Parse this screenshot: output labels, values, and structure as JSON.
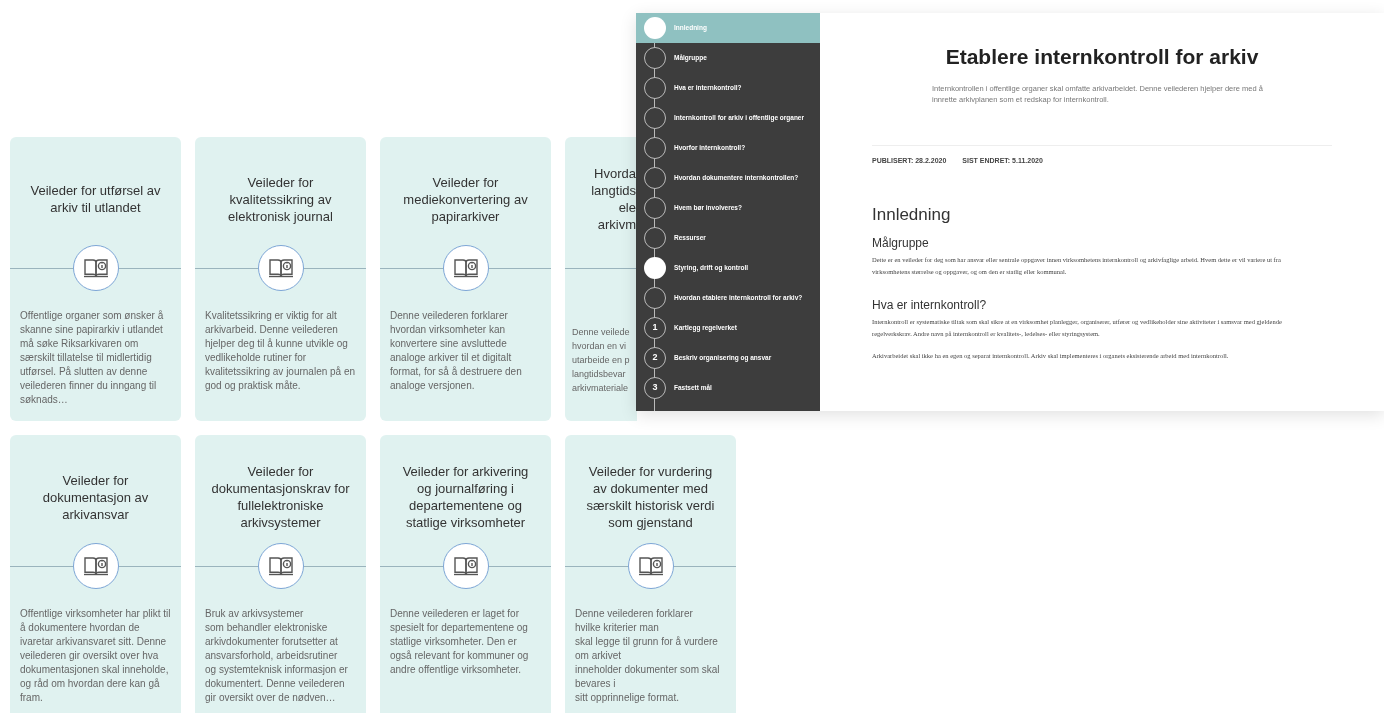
{
  "cards": [
    {
      "kind": "full",
      "title": "Veileder for utførsel av arkiv til utlandet",
      "body": "Offentlige organer som ønsker å skanne sine papirarkiv i utlandet må søke Riksarkivaren om særskilt tillatelse til midlertidig utførsel. På slutten av denne veilederen finner du inngang til søknads…"
    },
    {
      "kind": "full",
      "title": "Veileder for kvalitetssikring av elektronisk journal",
      "body": "Kvalitetssikring er viktig for alt arkivarbeid. Denne veilederen hjelper deg til å kunne utvikle og vedlikeholde rutiner for kvalitetssikring av journalen på en god og praktisk måte."
    },
    {
      "kind": "full",
      "title": "Veileder for mediekonvertering av papirarkiver",
      "body": "Denne veilederen forklarer hvordan virksomheter kan konvertere sine avsluttede analoge arkiver til et digitalt format, for så å destruere den analoge versjonen."
    },
    {
      "kind": "covered",
      "title_fragments": [
        "Hvorda",
        "langtids",
        "ele",
        "arkivm"
      ],
      "body_fragments": [
        "Denne veilede",
        "hvordan en vi",
        "utarbeide en p",
        "langtidsbevar",
        "arkivmateriale"
      ]
    },
    {
      "kind": "full",
      "title": "Veileder for dokumentasjon av arkivansvar",
      "body": "Offentlige virksomheter har plikt til å dokumentere hvordan de ivaretar arkivansvaret sitt. Denne veilederen gir oversikt over hva dokumentasjonen skal inneholde, og råd om hvordan dere kan gå fram."
    },
    {
      "kind": "full",
      "title": "Veileder for dokumentasjonskrav for fullelektroniske arkivsystemer",
      "body": "Bruk av arkivsystemer\nsom behandler elektroniske arkivdokumenter forutsetter at ansvarsforhold, arbeidsrutiner\nog systemteknisk informasjon er dokumentert. Denne veilederen gir oversikt over de nødven…"
    },
    {
      "kind": "full",
      "title": "Veileder for arkivering og journalføring i departementene og statlige virksomheter",
      "body": "Denne veilederen er laget for spesielt for departementene og statlige virksomheter. Den er også relevant for kommuner og andre offentlige virksomheter."
    },
    {
      "kind": "full",
      "title": "Veileder for vurdering av dokumenter med særskilt historisk verdi som gjenstand",
      "body": "Denne veilederen forklarer\nhvilke kriterier man\nskal legge til grunn for å vurdere\nom arkivet\ninneholder dokumenter som skal\nbevares i\nsitt opprinnelige format."
    }
  ],
  "preview": {
    "sidebar": {
      "items": [
        {
          "label": "Innledning",
          "kind": "section",
          "selected": true
        },
        {
          "label": "Målgruppe",
          "kind": "topic",
          "selected": false
        },
        {
          "label": "Hva er internkontroll?",
          "kind": "topic",
          "selected": false
        },
        {
          "label": "Internkontroll for arkiv i offentlige organer",
          "kind": "topic",
          "selected": false
        },
        {
          "label": "Hvorfor internkontroll?",
          "kind": "topic",
          "selected": false
        },
        {
          "label": "Hvordan dokumentere internkontrollen?",
          "kind": "topic",
          "selected": false
        },
        {
          "label": "Hvem bør involveres?",
          "kind": "topic",
          "selected": false
        },
        {
          "label": "Ressurser",
          "kind": "topic",
          "selected": false
        },
        {
          "label": "Styring, drift og kontroll",
          "kind": "section",
          "selected": false
        },
        {
          "label": "Hvordan etablere internkontroll for arkiv?",
          "kind": "topic",
          "selected": false
        },
        {
          "label": "Kartlegg regelverket",
          "kind": "step",
          "number": "1",
          "selected": false
        },
        {
          "label": "Beskriv organisering og ansvar",
          "kind": "step",
          "number": "2",
          "selected": false
        },
        {
          "label": "Fastsett mål",
          "kind": "step",
          "number": "3",
          "selected": false
        }
      ]
    },
    "title": "Etablere internkontroll for arkiv",
    "lead": "Internkontrollen i offentlige organer skal omfatte arkivarbeidet. Denne veilederen hjelper dere med å innrette arkivplanen som et redskap for internkontroll.",
    "meta": [
      "PUBLISERT: 28.2.2020",
      "SIST ENDRET: 5.11.2020"
    ],
    "section_heading": "Innledning",
    "subsections": [
      {
        "heading": "Målgruppe",
        "paragraphs": [
          "Dette er en veileder for deg som har ansvar eller sentrale oppgaver innen virksomhetens internkontroll og arkivfaglige arbeid. Hvem dette er vil variere ut fra virksomhetens størrelse og oppgaver, og om den er statlig eller kommunal."
        ]
      },
      {
        "heading": "Hva er internkontroll?",
        "paragraphs": [
          "Internkontroll er systematiske tiltak som skal sikre at en virksomhet planlegger, organiserer, utfører og vedlikeholder sine aktiviteter i samsvar med gjeldende regelverkskrav. Andre navn på internkontroll er kvalitets-, ledelses- eller styringsystem.",
          "Arkivarbeidet skal ikke ha en egen og separat internkontroll. Arkiv skal implementeres i organets eksisterende arbeid med internkontroll."
        ]
      }
    ]
  }
}
